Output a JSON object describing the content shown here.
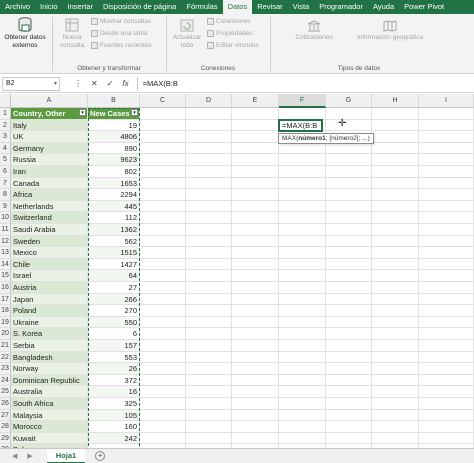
{
  "ribbon_tabs": [
    "Archivo",
    "Inicio",
    "Insertar",
    "Disposición de página",
    "Fórmulas",
    "Datos",
    "Revisar",
    "Vista",
    "Programador",
    "Ayuda",
    "Power Pivot"
  ],
  "active_tab": "Datos",
  "ribbon": {
    "get_data": "Obtener datos externos",
    "new_query": "Nueva consulta",
    "show_queries": "Mostrar consultas",
    "from_table": "Desde una tabla",
    "recent_sources": "Fuentes recientes",
    "group_get_transform": "Obtener y transformar",
    "refresh_all": "Actualizar todo",
    "connections": "Conexiones",
    "properties": "Propiedades",
    "edit_links": "Editar vínculos",
    "group_connections": "Conexiones",
    "stocks": "Cotizaciones",
    "geography": "Información geográfica",
    "group_data_types": "Tipos de datos"
  },
  "formula_bar": {
    "name_box": "B2",
    "formula": "=MAX(B:B"
  },
  "columns": [
    "A",
    "B",
    "C",
    "D",
    "E",
    "F",
    "G",
    "H",
    "I"
  ],
  "table_headers": {
    "col_a": "Country, Other",
    "col_b": "New Cases"
  },
  "rows": [
    {
      "n": "1"
    },
    {
      "n": "2",
      "country": "Italy",
      "cases": "19"
    },
    {
      "n": "3",
      "country": "UK",
      "cases": "4806"
    },
    {
      "n": "4",
      "country": "Germany",
      "cases": "890"
    },
    {
      "n": "5",
      "country": "Russia",
      "cases": "9623"
    },
    {
      "n": "6",
      "country": "Iran",
      "cases": "802"
    },
    {
      "n": "7",
      "country": "Canada",
      "cases": "1653"
    },
    {
      "n": "8",
      "country": "Africa",
      "cases": "2294"
    },
    {
      "n": "9",
      "country": "Netherlands",
      "cases": "445"
    },
    {
      "n": "10",
      "country": "Switzerland",
      "cases": "112"
    },
    {
      "n": "11",
      "country": "Saudi Arabia",
      "cases": "1362"
    },
    {
      "n": "12",
      "country": "Sweden",
      "cases": "562"
    },
    {
      "n": "13",
      "country": "Mexico",
      "cases": "1515"
    },
    {
      "n": "14",
      "country": "Chile",
      "cases": "1427"
    },
    {
      "n": "15",
      "country": "Israel",
      "cases": "64"
    },
    {
      "n": "16",
      "country": "Austria",
      "cases": "27"
    },
    {
      "n": "17",
      "country": "Japan",
      "cases": "266"
    },
    {
      "n": "18",
      "country": "Poland",
      "cases": "270"
    },
    {
      "n": "19",
      "country": "Ukraine",
      "cases": "550"
    },
    {
      "n": "20",
      "country": "S. Korea",
      "cases": "6"
    },
    {
      "n": "21",
      "country": "Serbia",
      "cases": "157"
    },
    {
      "n": "22",
      "country": "Bangladesh",
      "cases": "553"
    },
    {
      "n": "23",
      "country": "Norway",
      "cases": "26"
    },
    {
      "n": "24",
      "country": "Dominican Republic",
      "cases": "372"
    },
    {
      "n": "25",
      "country": "Australia",
      "cases": "16"
    },
    {
      "n": "26",
      "country": "South Africa",
      "cases": "325"
    },
    {
      "n": "27",
      "country": "Malaysia",
      "cases": "105"
    },
    {
      "n": "28",
      "country": "Morocco",
      "cases": "160"
    },
    {
      "n": "29",
      "country": "Kuwait",
      "cases": "242"
    },
    {
      "n": "30",
      "country": "Belarus",
      "cases": ""
    }
  ],
  "active_cell_text": "=MAX(B:B",
  "tooltip": {
    "fn": "MAX(",
    "arg1": "número1",
    "rest": "; [número2]; ...)"
  },
  "sheet_tab": "Hoja1",
  "colors": {
    "excel_green": "#217346",
    "table_header": "#5b9a3f"
  }
}
